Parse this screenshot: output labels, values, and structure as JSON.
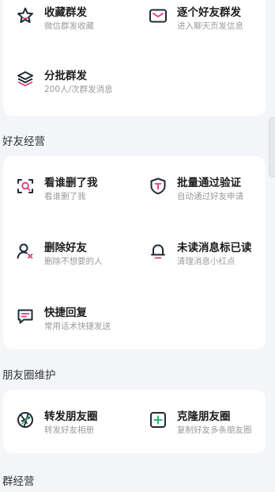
{
  "colors": {
    "accent": "#e0397e",
    "icon": "#1f2a37",
    "green": "#2fb36d",
    "bg": "#f3f5f8"
  },
  "card_top": {
    "items": [
      {
        "title": "收藏群发",
        "subtitle": "微信群发收藏",
        "icon": "star-icon"
      },
      {
        "title": "逐个好友群发",
        "subtitle": "进入聊天页发信息",
        "icon": "envelope-icon"
      },
      {
        "title": "分批群发",
        "subtitle": "200人/次群发消息",
        "icon": "layers-icon"
      }
    ]
  },
  "friend_ops": {
    "section_title": "好友经营",
    "items": [
      {
        "title": "看谁删了我",
        "subtitle": "看谁删了我",
        "icon": "scan-search-icon"
      },
      {
        "title": "批量通过验证",
        "subtitle": "自动通过好友申请",
        "icon": "shield-icon"
      },
      {
        "title": "删除好友",
        "subtitle": "删除不想要的人",
        "icon": "user-remove-icon"
      },
      {
        "title": "未读消息标已读",
        "subtitle": "清理消息小红点",
        "icon": "bell-icon"
      },
      {
        "title": "快捷回复",
        "subtitle": "常用话术快捷发送",
        "icon": "chat-reply-icon"
      }
    ]
  },
  "moments": {
    "section_title": "朋友圈维护",
    "items": [
      {
        "title": "转发朋友圈",
        "subtitle": "转发好友相册",
        "icon": "aperture-icon"
      },
      {
        "title": "克隆朋友圈",
        "subtitle": "复制好友多条朋友圈",
        "icon": "plus-square-icon"
      }
    ]
  },
  "group_ops": {
    "section_title": "群经营"
  }
}
